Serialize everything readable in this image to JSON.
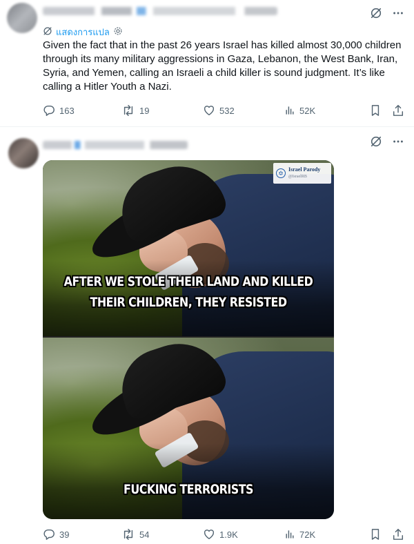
{
  "tweet1": {
    "translate_label": "แสดงการแปล",
    "text": "Given the fact that in the past 26 years Israel has killed almost 30,000 children through its many military aggressions in Gaza, Lebanon, the West Bank, Iran, Syria, and Yemen, calling an Israeli a child killer is sound judgment. It’s like calling a Hitler Youth a Nazi.",
    "replies": "163",
    "reposts": "19",
    "likes": "532",
    "views": "52K"
  },
  "tweet2": {
    "meme": {
      "caption_top": "AFTER WE STOLE THEIR LAND AND KILLED THEIR CHILDREN, THEY RESISTED",
      "caption_bottom": "FUCKING TERRORISTS",
      "watermark_title": "Israel Parody",
      "watermark_handle": "@IsraelRB"
    },
    "replies": "39",
    "reposts": "54",
    "likes": "1.9K",
    "views": "72K"
  },
  "icons": {
    "grok": "grok-icon",
    "more": "more-icon",
    "translate": "translate-icon",
    "reply": "reply-icon",
    "repost": "repost-icon",
    "like": "like-icon",
    "views": "views-icon",
    "bookmark": "bookmark-icon",
    "share": "share-icon"
  },
  "colors": {
    "text": "#0f1419",
    "secondary": "#536471",
    "link": "#1d9bf0",
    "divider": "#eff3f4"
  }
}
